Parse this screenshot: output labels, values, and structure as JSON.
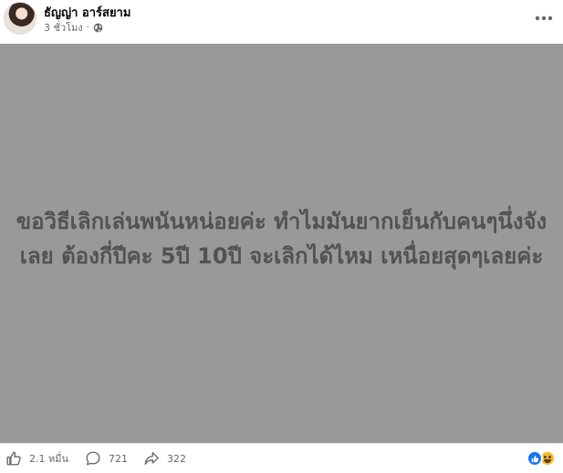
{
  "post": {
    "author": "ธัญญ่า อาร์สยาม",
    "time": "3 ชั่วโมง",
    "separator": "·",
    "privacy_icon": "globe-icon",
    "image_text": "ขอวิธีเลิกเล่นพนันหน่อยค่ะ ทำไมมันยากเย็นกับคนๆนึ่งจังเลย ต้องกี่ปีคะ 5ปี 10ปี จะเลิกได้ไหม เหนื่อยสุดๆเลยค่ะ"
  },
  "footer": {
    "likes": "2.1 หมื่น",
    "comments": "721",
    "shares": "322"
  },
  "colors": {
    "image_bg": "#999999",
    "image_text": "#525252",
    "meta": "#65676b",
    "like_blue": "#1877f2"
  }
}
